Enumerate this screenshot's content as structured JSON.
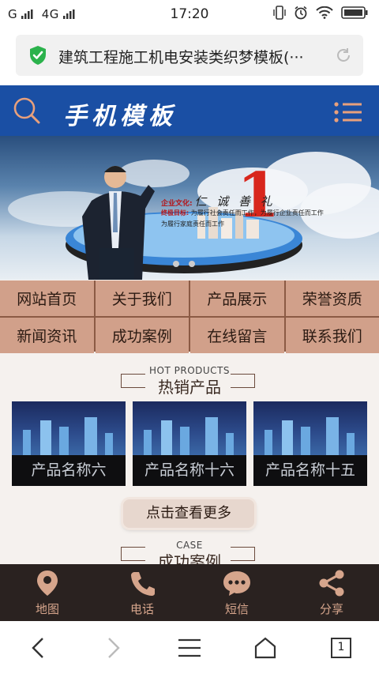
{
  "status": {
    "left": "G   4G",
    "time": "17:20"
  },
  "browser": {
    "url_title": "建筑工程施工机电安装类织梦模板(···"
  },
  "site": {
    "title": "手机模板"
  },
  "banner": {
    "culture_label": "企业文化:",
    "culture_value": "仁 诚 善 礼",
    "goal_label": "终极目标:",
    "goal_text": "为履行社会责任而工作，为履行企业责任而工作",
    "goal_text2": "为履行家庭责任而工作",
    "big_number": "1"
  },
  "nav": [
    "网站首页",
    "关于我们",
    "产品展示",
    "荣誉资质",
    "新闻资讯",
    "成功案例",
    "在线留言",
    "联系我们"
  ],
  "hot_products": {
    "en": "HOT PRODUCTS",
    "cn": "热销产品",
    "items": [
      "产品名称六",
      "产品名称十六",
      "产品名称十五"
    ]
  },
  "more_button": "点击查看更多",
  "cases": {
    "en": "CASE",
    "cn": "成功案例"
  },
  "bottom_bar": [
    "地图",
    "电话",
    "短信",
    "分享"
  ],
  "browser_nav": {
    "tabs_count": "1"
  },
  "colors": {
    "header_blue": "#1a4fa4",
    "nav_bg": "#d1a08a",
    "accent": "#d6a58c",
    "bottom_bg": "#2a2220"
  }
}
